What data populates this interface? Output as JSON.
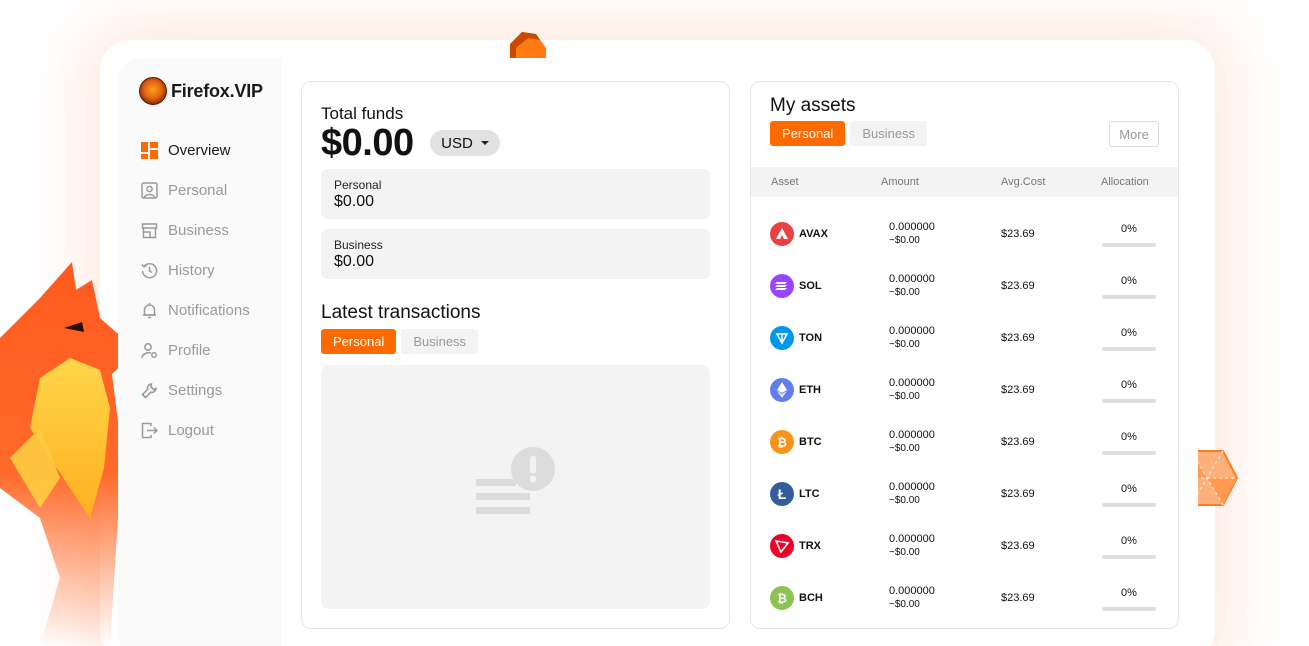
{
  "brand": {
    "name": "Firefox.VIP"
  },
  "sidebar": {
    "items": [
      {
        "label": "Overview",
        "icon": "dashboard-icon",
        "active": true
      },
      {
        "label": "Personal",
        "icon": "user-card-icon",
        "active": false
      },
      {
        "label": "Business",
        "icon": "store-icon",
        "active": false
      },
      {
        "label": "History",
        "icon": "history-icon",
        "active": false
      },
      {
        "label": "Notifications",
        "icon": "bell-icon",
        "active": false
      },
      {
        "label": "Profile",
        "icon": "user-gear-icon",
        "active": false
      },
      {
        "label": "Settings",
        "icon": "wrench-icon",
        "active": false
      },
      {
        "label": "Logout",
        "icon": "logout-icon",
        "active": false
      }
    ]
  },
  "funds": {
    "title": "Total funds",
    "amount": "$0.00",
    "currency": "USD",
    "personal_label": "Personal",
    "personal_value": "$0.00",
    "business_label": "Business",
    "business_value": "$0.00"
  },
  "transactions": {
    "title": "Latest transactions",
    "tab_personal": "Personal",
    "tab_business": "Business"
  },
  "assets": {
    "title": "My assets",
    "tab_personal": "Personal",
    "tab_business": "Business",
    "more": "More",
    "columns": {
      "asset": "Asset",
      "amount": "Amount",
      "avg_cost": "Avg.Cost",
      "allocation": "Allocation"
    },
    "rows": [
      {
        "symbol": "AVAX",
        "amount": "0.000000",
        "fiat": "~$0.00",
        "avg_cost": "$23.69",
        "allocation": "0%",
        "allocation_fraction": 0,
        "color": "#e84142"
      },
      {
        "symbol": "SOL",
        "amount": "0.000000",
        "fiat": "~$0.00",
        "avg_cost": "$23.69",
        "allocation": "0%",
        "allocation_fraction": 0,
        "color": "#9945ff"
      },
      {
        "symbol": "TON",
        "amount": "0.000000",
        "fiat": "~$0.00",
        "avg_cost": "$23.69",
        "allocation": "0%",
        "allocation_fraction": 0,
        "color": "#0098ea"
      },
      {
        "symbol": "ETH",
        "amount": "0.000000",
        "fiat": "~$0.00",
        "avg_cost": "$23.69",
        "allocation": "0%",
        "allocation_fraction": 0,
        "color": "#627eea"
      },
      {
        "symbol": "BTC",
        "amount": "0.000000",
        "fiat": "~$0.00",
        "avg_cost": "$23.69",
        "allocation": "0%",
        "allocation_fraction": 0,
        "color": "#f7931a"
      },
      {
        "symbol": "LTC",
        "amount": "0.000000",
        "fiat": "~$0.00",
        "avg_cost": "$23.69",
        "allocation": "0%",
        "allocation_fraction": 0,
        "color": "#345d9d"
      },
      {
        "symbol": "TRX",
        "amount": "0.000000",
        "fiat": "~$0.00",
        "avg_cost": "$23.69",
        "allocation": "0%",
        "allocation_fraction": 0,
        "color": "#ef0027"
      },
      {
        "symbol": "BCH",
        "amount": "0.000000",
        "fiat": "~$0.00",
        "avg_cost": "$23.69",
        "allocation": "0%",
        "allocation_fraction": 0,
        "color": "#8dc351"
      }
    ]
  },
  "theme": {
    "accent": "#ff6a00",
    "muted_text": "#9a9a9a",
    "panel_bg": "#f3f3f3"
  }
}
